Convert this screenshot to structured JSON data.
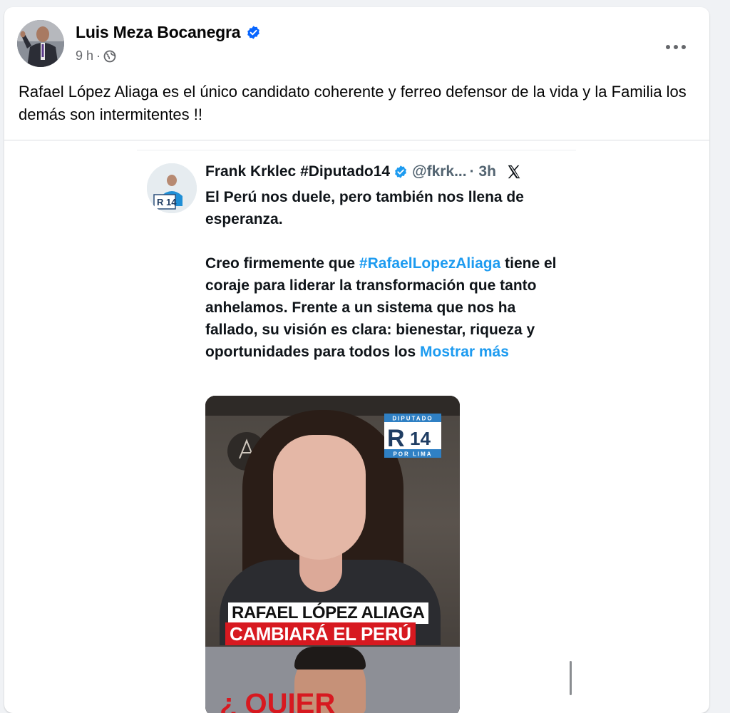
{
  "post": {
    "author_name": "Luis Meza Bocanegra",
    "time": "9 h",
    "separator": "·",
    "text": "Rafael López Aliaga es el único candidato coherente y ferreo defensor de la vida y la Familia los demás son intermitentes !!"
  },
  "shared_tweet": {
    "name": "Frank Krklec #Diputado14",
    "handle": "@fkrk...",
    "time": "· 3h",
    "avatar_badge": "R 14",
    "paragraph1": "El Perú nos duele, pero también nos llena de esperanza.",
    "paragraph2_start": "Creo firmemente que ",
    "hashtag": "#RafaelLopezAliaga",
    "paragraph2_rest": " tiene el coraje para liderar la transformación que tanto anhelamos. Frente a un sistema que nos ha fallado, su visión es clara: bienestar, riqueza y oportunidades para todos los ",
    "show_more": "Mostrar más",
    "video": {
      "badge_top": "DIPUTADO",
      "badge_mid_letter": "R",
      "badge_mid_number": "14",
      "badge_bottom": "POR LIMA",
      "caption_line1": "RAFAEL LÓPEZ ALIAGA",
      "caption_line2": "CAMBIARÁ EL PERÚ",
      "bottom_partial": "¿ QUIER"
    }
  },
  "colors": {
    "verified_blue": "#0866ff",
    "link_blue": "#1d9bf0",
    "caption_red": "#d71920",
    "background": "#f0f2f5"
  },
  "icons": {
    "verified": "verified-badge-icon",
    "audience": "globe-icon",
    "more": "more-options-icon",
    "x_logo": "x-logo-icon"
  }
}
